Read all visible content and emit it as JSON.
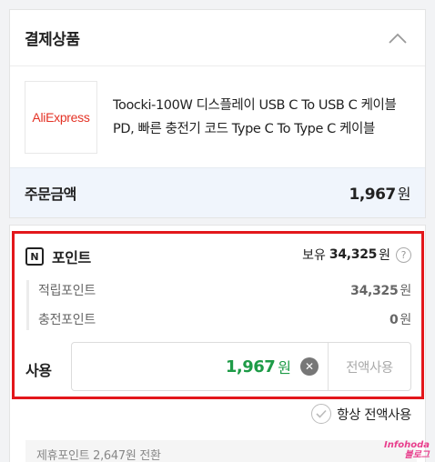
{
  "section": {
    "title": "결제상품"
  },
  "product": {
    "seller_logo": "AliExpress",
    "name": "Toocki-100W 디스플레이 USB C To USB C 케이블 PD, 빠른 충전기 코드 Type C To Type C 케이블"
  },
  "order": {
    "label": "주문금액",
    "amount": "1,967",
    "unit": "원"
  },
  "points": {
    "icon_letter": "N",
    "title": "포인트",
    "holding_label": "보유",
    "holding_amount": "34,325",
    "unit": "원",
    "help_glyph": "?",
    "rows": [
      {
        "label": "적립포인트",
        "value": "34,325",
        "unit": "원"
      },
      {
        "label": "충전포인트",
        "value": "0",
        "unit": "원"
      }
    ],
    "use_label": "사용",
    "use_value": "1,967",
    "use_unit": "원",
    "use_all_button": "전액사용",
    "always_use_all": "항상 전액사용"
  },
  "bottom_notice": "제휴포인트 2,647원 전환",
  "watermark": {
    "line1": "Infohoda",
    "line2": "블로그"
  },
  "colors": {
    "highlight_border": "#e3171b",
    "use_value": "#1e9b47",
    "order_bg": "#f0f5fc"
  }
}
